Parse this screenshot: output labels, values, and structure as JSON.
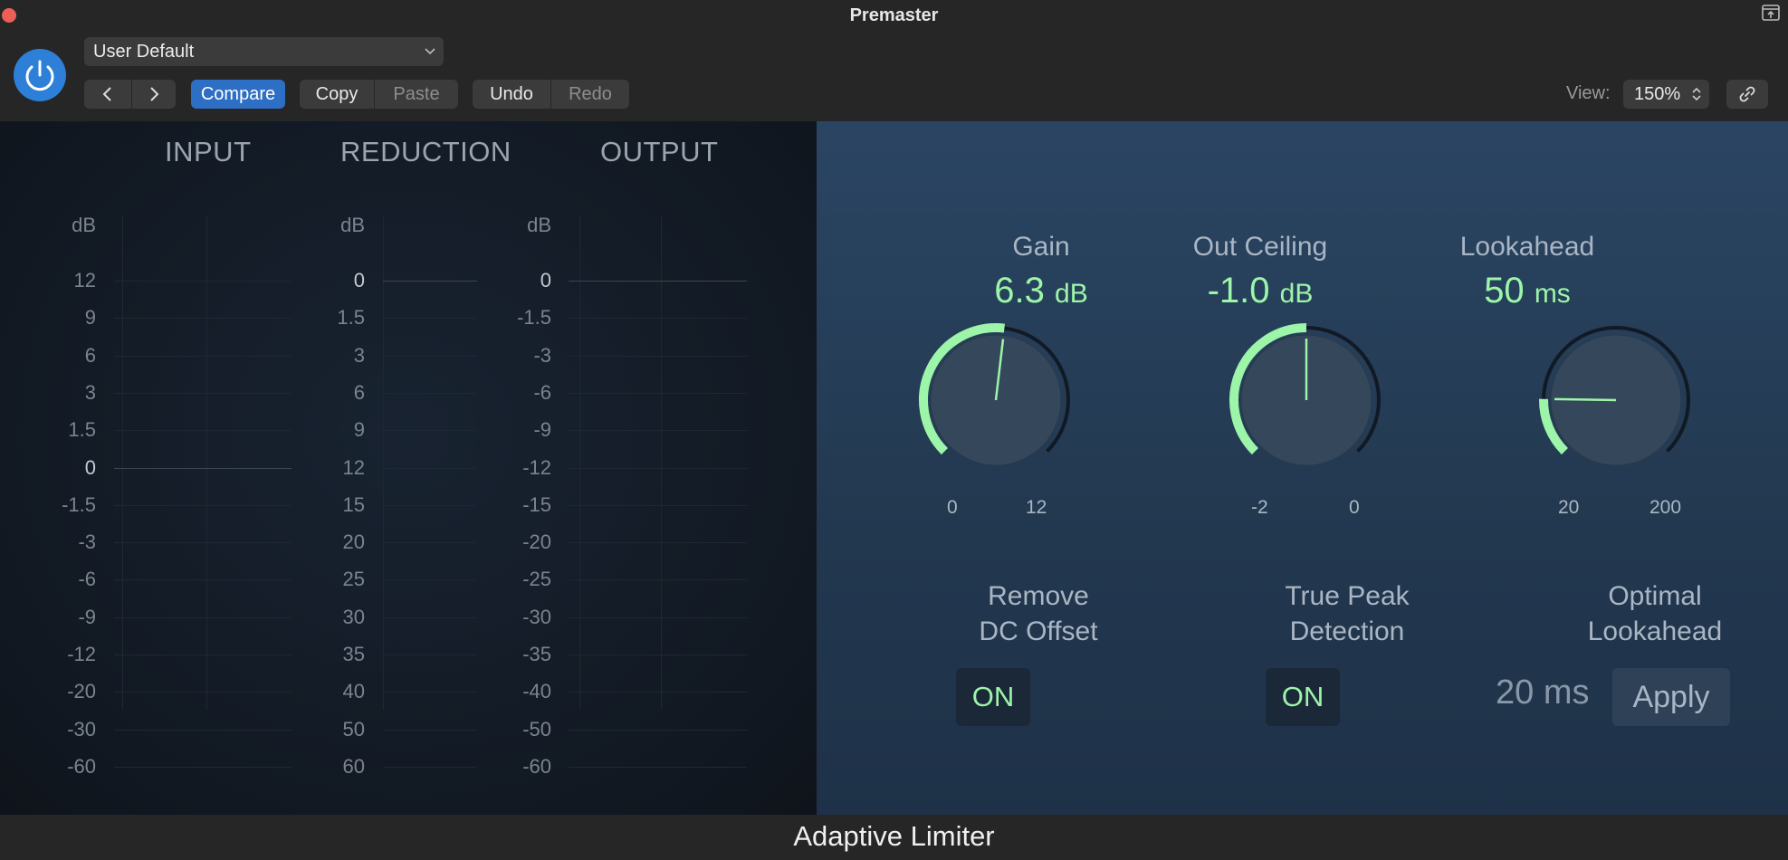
{
  "window": {
    "title": "Premaster",
    "plugin_name": "Adaptive Limiter"
  },
  "toolbar": {
    "preset": "User Default",
    "compare": "Compare",
    "copy": "Copy",
    "paste": "Paste",
    "undo": "Undo",
    "redo": "Redo",
    "view_label": "View:",
    "view_value": "150%"
  },
  "meters": {
    "headers": [
      "INPUT",
      "REDUCTION",
      "OUTPUT"
    ],
    "unit": "dB",
    "input_ticks": [
      "12",
      "9",
      "6",
      "3",
      "1.5",
      "0",
      "-1.5",
      "-3",
      "-6",
      "-9",
      "-12",
      "-20",
      "-30",
      "-60"
    ],
    "reduction_ticks": [
      "0",
      "1.5",
      "3",
      "6",
      "9",
      "12",
      "15",
      "20",
      "25",
      "30",
      "35",
      "40",
      "50",
      "60"
    ],
    "output_ticks": [
      "0",
      "-1.5",
      "-3",
      "-6",
      "-9",
      "-12",
      "-15",
      "-20",
      "-25",
      "-30",
      "-35",
      "-40",
      "-50",
      "-60"
    ]
  },
  "controls": {
    "gain": {
      "title": "Gain",
      "value": "6.3",
      "unit": "dB",
      "min": "0",
      "max": "12",
      "level": 0.525,
      "accent": "#9cf5a8"
    },
    "out_ceiling": {
      "title": "Out Ceiling",
      "value": "-1.0",
      "unit": "dB",
      "min": "-2",
      "max": "0",
      "level": 0.5,
      "accent": "#9cf5a8"
    },
    "lookahead": {
      "title": "Lookahead",
      "value": "50",
      "unit": "ms",
      "min": "20",
      "max": "200",
      "level": 0.17,
      "accent": "#9cf5a8"
    },
    "remove_dc": {
      "title_line1": "Remove",
      "title_line2": "DC Offset",
      "state": "ON"
    },
    "true_peak": {
      "title_line1": "True Peak",
      "title_line2": "Detection",
      "state": "ON"
    },
    "optimal": {
      "title_line1": "Optimal",
      "title_line2": "Lookahead",
      "value": "20 ms",
      "apply": "Apply"
    }
  },
  "icons": [
    "close-dot-icon",
    "expand-icon",
    "power-icon",
    "chevron-down-icon",
    "chevron-left-icon",
    "chevron-right-icon",
    "stepper-icon",
    "link-icon"
  ]
}
